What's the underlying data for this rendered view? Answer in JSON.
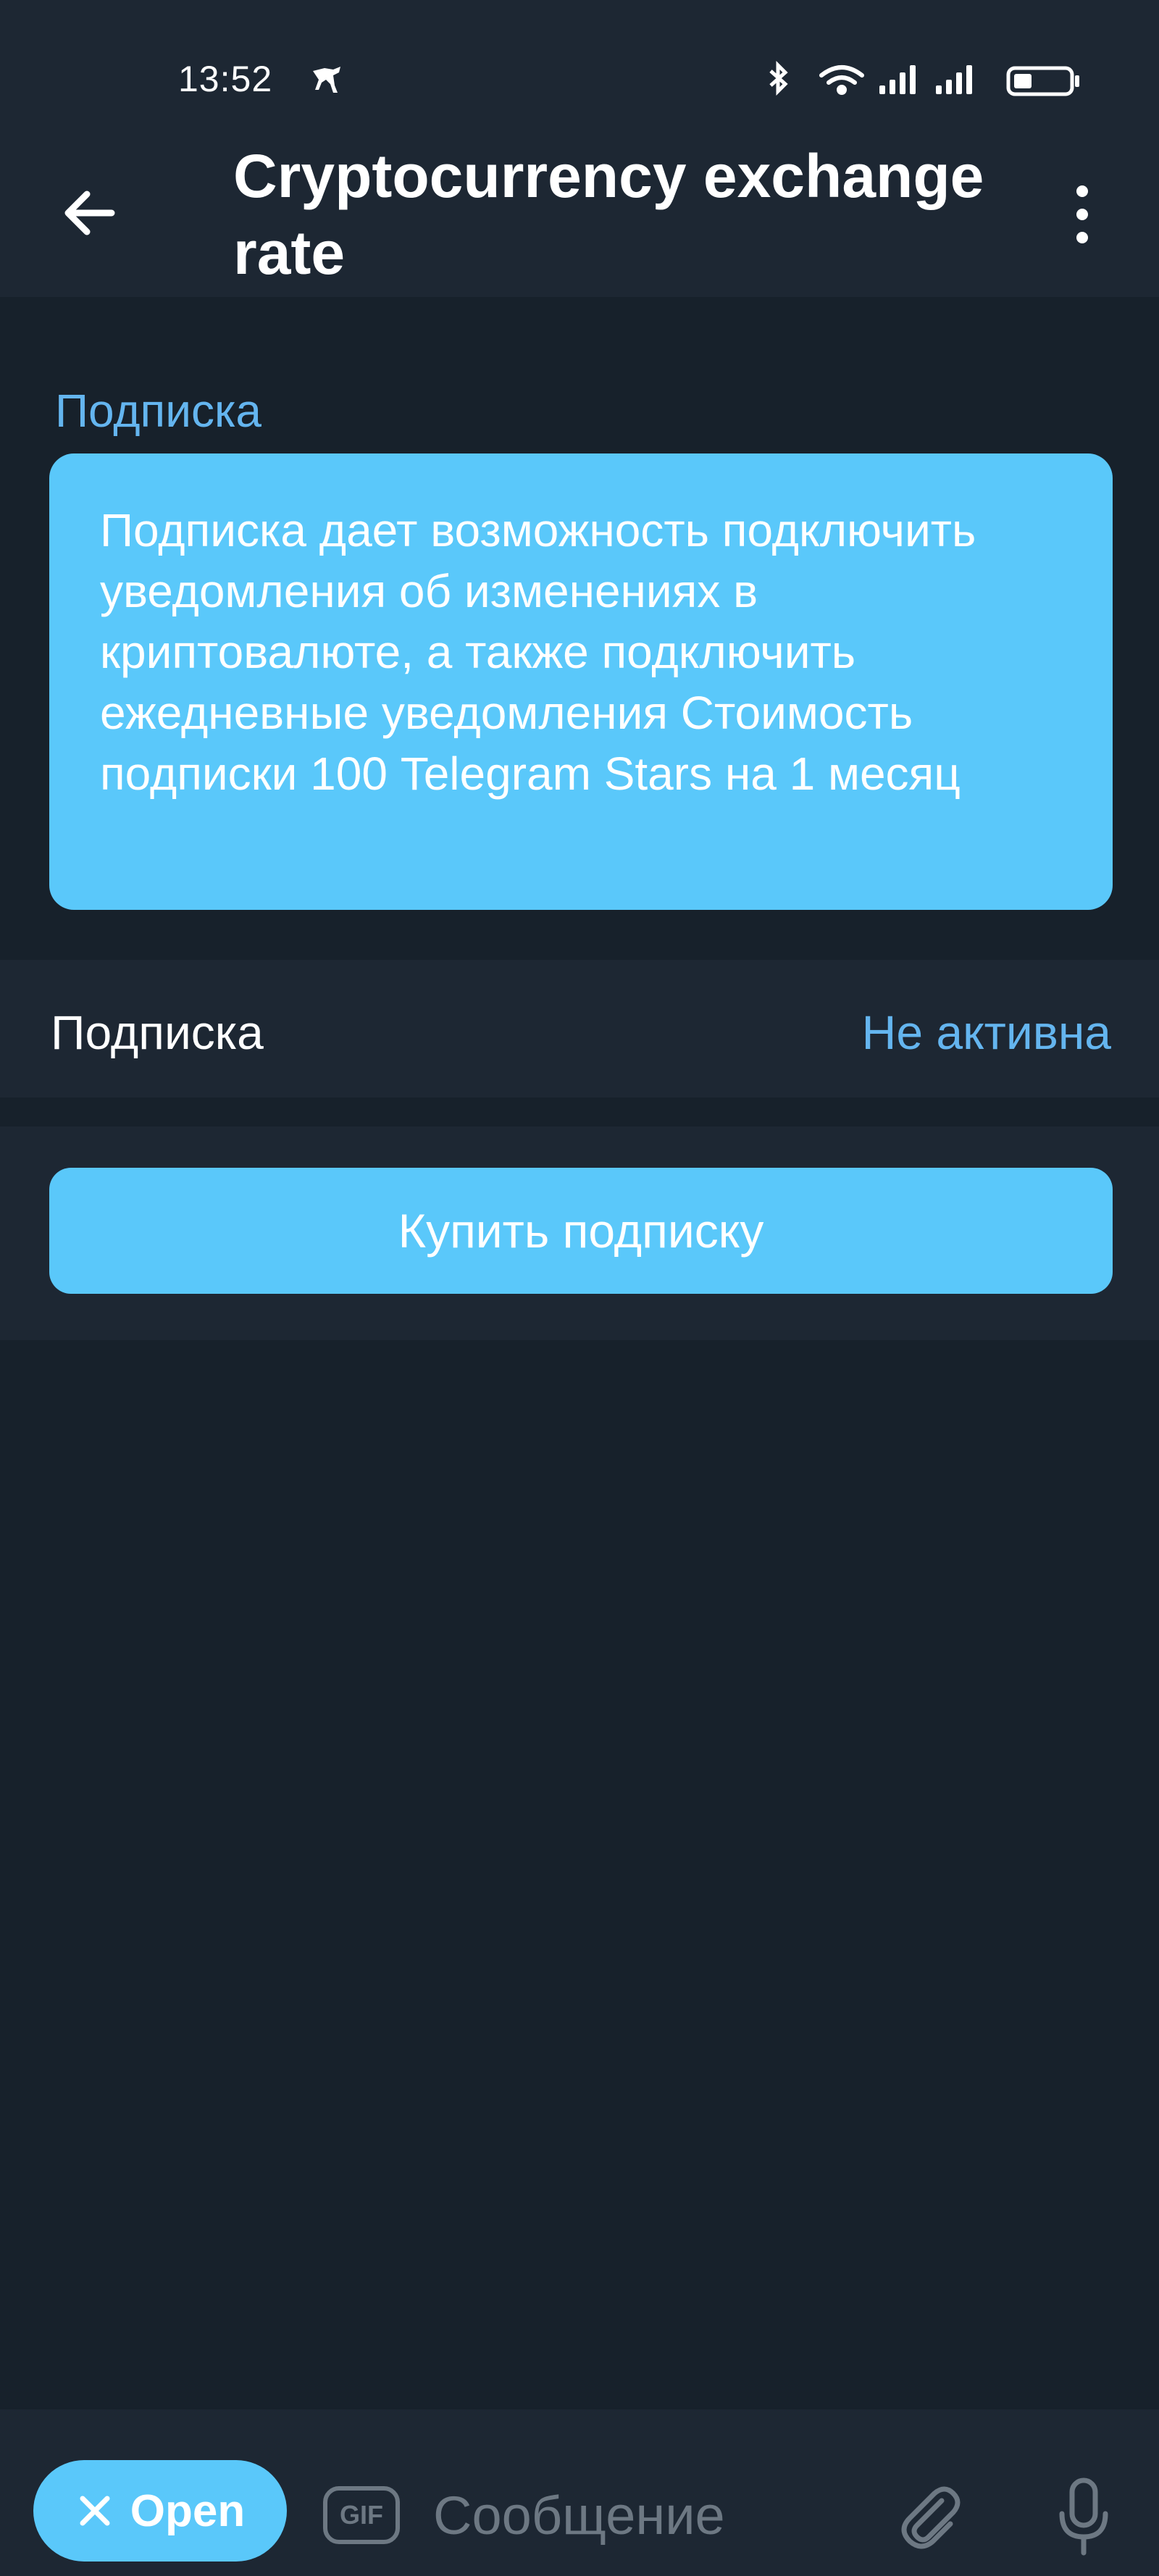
{
  "status_bar": {
    "time": "13:52"
  },
  "header": {
    "title": "Cryptocurrency exchange rate"
  },
  "subscription_section": {
    "label": "Подписка",
    "info_text": "Подписка дает возможность подключить уведомления об изменениях в криптовалюте, а также подключить ежедневные уведомления Стоимость подписки 100 Telegram Stars на 1 месяц"
  },
  "status_row": {
    "label": "Подписка",
    "value": "Не активна"
  },
  "buy_button": {
    "label": "Купить подписку"
  },
  "bottom_bar": {
    "open_label": "Open",
    "gif_label": "GIF",
    "message_placeholder": "Сообщение"
  },
  "colors": {
    "background": "#17212b",
    "surface": "#1d2733",
    "accent": "#5ac8fa",
    "link": "#64b5ef",
    "muted": "#6d7883"
  }
}
